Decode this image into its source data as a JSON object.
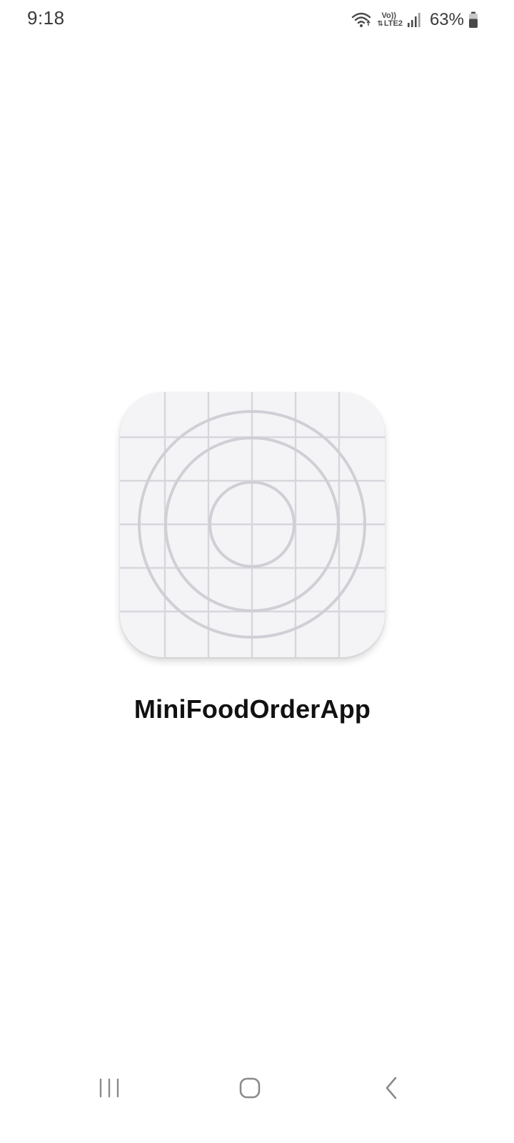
{
  "status_bar": {
    "time": "9:18",
    "lte_top": "Vo))",
    "lte_bottom": "LTE2",
    "battery_text": "63%",
    "battery_level": 0.63,
    "icons": [
      "wifi-icon",
      "lte-icon",
      "signal-icon",
      "battery-icon"
    ]
  },
  "splash": {
    "app_name": "MiniFoodOrderApp",
    "icon": "placeholder-app-icon",
    "icon_background": "#f4f4f7",
    "icon_line_color": "#d0d0d6"
  },
  "nav_bar": {
    "buttons": [
      "recents-icon",
      "home-icon",
      "back-icon"
    ]
  },
  "colors": {
    "background": "#ffffff",
    "text_primary": "#111111",
    "status_text": "#3a3a3a",
    "nav_icon": "#8a8a8a"
  }
}
